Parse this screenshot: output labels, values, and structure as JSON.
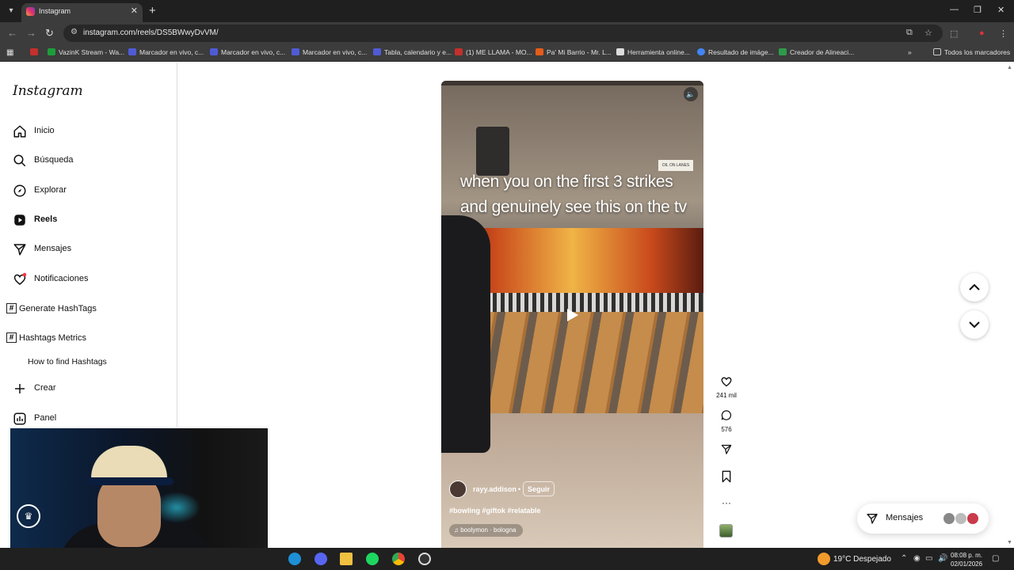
{
  "browser": {
    "tab_title": "Instagram",
    "url": "instagram.com/reels/DS5BWwyDvVM/",
    "bookmarks": [
      {
        "label": "VazinK Stream - Wa...",
        "color": "#c4302b"
      },
      {
        "label": "Marcador en vivo, c...",
        "color": "#4f5bd5"
      },
      {
        "label": "Marcador en vivo, c...",
        "color": "#4f5bd5"
      },
      {
        "label": "Marcador en vivo, c...",
        "color": "#4f5bd5"
      },
      {
        "label": "Tabla, calendario y e...",
        "color": "#4f5bd5"
      },
      {
        "label": "(1) ME LLAMA - MO...",
        "color": "#c4302b"
      },
      {
        "label": "Pa' Mi Barrio - Mr. L...",
        "color": "#e65c1a"
      },
      {
        "label": "Herramienta online...",
        "color": "#dddddd"
      },
      {
        "label": "Resultado de imáge...",
        "color": "#4285f4"
      },
      {
        "label": "Creador de Alineaci...",
        "color": "#2e9a4b"
      }
    ],
    "all_bookmarks": "Todos los marcadores"
  },
  "sidebar": {
    "logo": "Instagram",
    "items": [
      {
        "label": "Inicio"
      },
      {
        "label": "Búsqueda"
      },
      {
        "label": "Explorar"
      },
      {
        "label": "Reels"
      },
      {
        "label": "Mensajes"
      },
      {
        "label": "Notificaciones"
      }
    ],
    "hashtags": [
      {
        "label": "Generate HashTags"
      },
      {
        "label": "Hashtags Metrics"
      }
    ],
    "how_to": "How to find Hashtags",
    "create": "Crear",
    "panel": "Panel"
  },
  "reel": {
    "caption_line1": "when you on the first 3 strikes",
    "caption_line2": "and genuinely see this on the tv",
    "sign_text": "OIL ON LANES",
    "username": "rayy.addison",
    "separator": "•",
    "follow_label": "Seguir",
    "tags": "#bowling #giftok #relatable",
    "audio": "boolymon · bologna"
  },
  "actions": {
    "likes": "241 mil",
    "comments": "576"
  },
  "messages_pill": {
    "label": "Mensajes"
  },
  "taskbar": {
    "weather": "19°C  Despejado",
    "time": "08:08 p. m.",
    "date": "02/01/2026"
  },
  "colors": {
    "accent_notification": "#ff3040",
    "chrome_dark": "#3c3c3c"
  }
}
